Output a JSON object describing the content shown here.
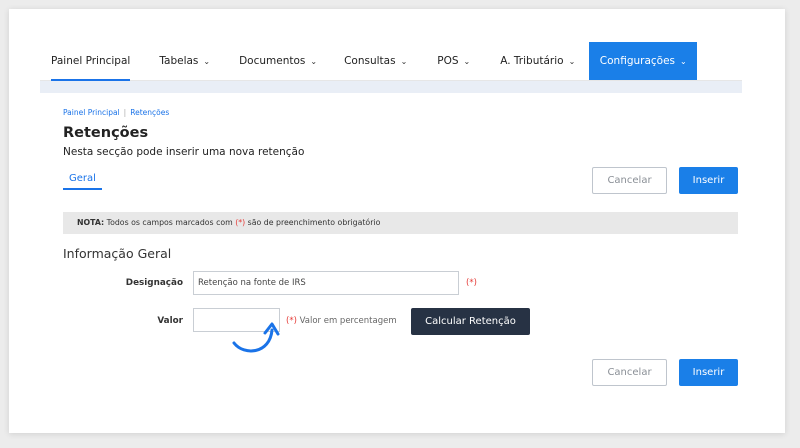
{
  "nav": {
    "items": [
      {
        "label": "Painel Principal"
      },
      {
        "label": "Tabelas"
      },
      {
        "label": "Documentos"
      },
      {
        "label": "Consultas"
      },
      {
        "label": "POS"
      },
      {
        "label": "A. Tributário"
      },
      {
        "label": "Configurações"
      }
    ]
  },
  "breadcrumb": {
    "home": "Painel Principal",
    "sep": "|",
    "current": "Retenções"
  },
  "page": {
    "title": "Retenções",
    "subtitle": "Nesta secção pode inserir uma nova retenção"
  },
  "tabs": [
    {
      "label": "Geral"
    }
  ],
  "actions": {
    "cancel": "Cancelar",
    "insert": "Inserir"
  },
  "note": {
    "prefix": "NOTA:",
    "text_before": " Todos os campos marcados com ",
    "marker": "(*)",
    "text_after": " são de preenchimento obrigatório"
  },
  "section": {
    "title": "Informação Geral"
  },
  "form": {
    "designacao": {
      "label": "Designação",
      "value": "Retenção na fonte de IRS",
      "required": "(*)"
    },
    "valor": {
      "label": "Valor",
      "value": "",
      "required": "(*)",
      "hint": " Valor em percentagem"
    },
    "calc_button": "Calcular Retenção"
  },
  "colors": {
    "accent": "#1a7fe8",
    "dark_button": "#273244",
    "required": "#e53935"
  },
  "icons": {
    "chevron": "chevron-down-icon",
    "arrow": "curved-arrow-icon"
  }
}
